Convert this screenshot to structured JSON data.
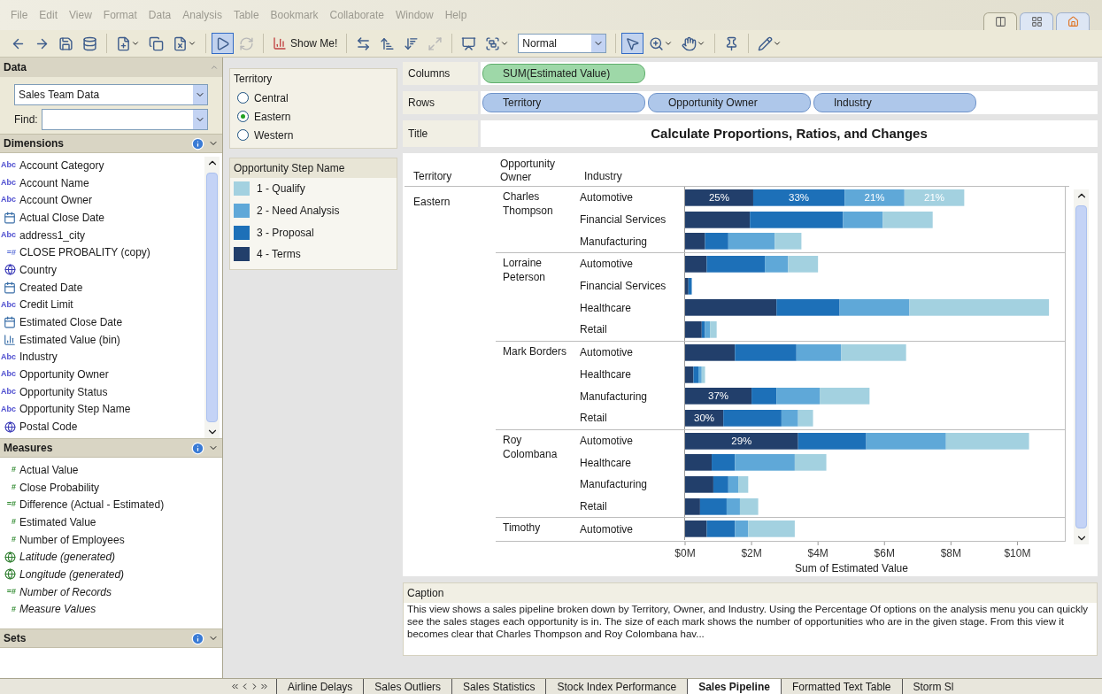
{
  "menu": [
    "File",
    "Edit",
    "View",
    "Format",
    "Data",
    "Analysis",
    "Table",
    "Bookmark",
    "Collaborate",
    "Window",
    "Help"
  ],
  "view_tabs": [
    {
      "kind": "sheet",
      "selected": true
    },
    {
      "kind": "grid",
      "selected": false
    },
    {
      "kind": "home",
      "selected": false
    }
  ],
  "toolbar": [
    {
      "kind": "back",
      "selected": false
    },
    {
      "kind": "forward",
      "selected": false
    },
    {
      "kind": "save",
      "selected": false
    },
    {
      "kind": "connect",
      "selected": false
    },
    {
      "kind": "sep"
    },
    {
      "kind": "new-sheet",
      "selected": false,
      "caret": true
    },
    {
      "kind": "duplicate",
      "selected": false
    },
    {
      "kind": "clear",
      "selected": false,
      "caret": true
    },
    {
      "kind": "sep"
    },
    {
      "kind": "run",
      "selected": true
    },
    {
      "kind": "refresh",
      "selected": false,
      "disabled": true
    },
    {
      "kind": "sep"
    },
    {
      "kind": "show-me",
      "label": "Show Me!",
      "selected": false
    },
    {
      "kind": "sep"
    },
    {
      "kind": "swap",
      "selected": false
    },
    {
      "kind": "sort-asc",
      "selected": false
    },
    {
      "kind": "sort-desc",
      "selected": false
    },
    {
      "kind": "fit",
      "selected": false,
      "disabled": true
    },
    {
      "kind": "sep"
    },
    {
      "kind": "present",
      "selected": false
    },
    {
      "kind": "group",
      "selected": false,
      "caret": true
    },
    {
      "kind": "select",
      "value": "Normal"
    },
    {
      "kind": "sep"
    },
    {
      "kind": "pointer",
      "selected": true
    },
    {
      "kind": "zoom",
      "selected": false,
      "caret": true
    },
    {
      "kind": "pan",
      "selected": false,
      "caret": true
    },
    {
      "kind": "sep"
    },
    {
      "kind": "pin",
      "selected": false
    },
    {
      "kind": "sep"
    },
    {
      "kind": "pen",
      "selected": false,
      "caret": true
    }
  ],
  "data_panel": {
    "title": "Data",
    "source": "Sales Team Data",
    "find_label": "Find:"
  },
  "dimensions": {
    "title": "Dimensions",
    "items": [
      {
        "kind": "string",
        "badge": "Abc",
        "name": "Account Category"
      },
      {
        "kind": "string",
        "badge": "Abc",
        "name": "Account Name"
      },
      {
        "kind": "string",
        "badge": "Abc",
        "name": "Account Owner"
      },
      {
        "kind": "date",
        "name": "Actual Close Date"
      },
      {
        "kind": "string",
        "badge": "Abc",
        "name": "address1_city"
      },
      {
        "kind": "calc",
        "badge": "=#",
        "name": "CLOSE PROBALITY (copy)"
      },
      {
        "kind": "geo",
        "name": "Country"
      },
      {
        "kind": "date",
        "name": "Created Date"
      },
      {
        "kind": "string",
        "badge": "Abc",
        "name": "Credit Limit"
      },
      {
        "kind": "date",
        "name": "Estimated Close Date"
      },
      {
        "kind": "bin",
        "name": "Estimated Value (bin)"
      },
      {
        "kind": "string",
        "badge": "Abc",
        "name": "Industry"
      },
      {
        "kind": "string",
        "badge": "Abc",
        "name": "Opportunity Owner"
      },
      {
        "kind": "string",
        "badge": "Abc",
        "name": "Opportunity Status"
      },
      {
        "kind": "string",
        "badge": "Abc",
        "name": "Opportunity Step Name"
      },
      {
        "kind": "geo",
        "name": "Postal Code"
      }
    ]
  },
  "measures": {
    "title": "Measures",
    "items": [
      {
        "kind": "number",
        "badge": "#",
        "name": "Actual Value",
        "generated": false
      },
      {
        "kind": "number",
        "badge": "#",
        "name": "Close Probability",
        "generated": false
      },
      {
        "kind": "calc",
        "badge": "=#",
        "name": "Difference (Actual - Estimated)",
        "generated": false
      },
      {
        "kind": "number",
        "badge": "#",
        "name": "Estimated Value",
        "generated": false
      },
      {
        "kind": "number",
        "badge": "#",
        "name": "Number of Employees",
        "generated": false
      },
      {
        "kind": "geo",
        "name": "Latitude (generated)",
        "generated": true
      },
      {
        "kind": "geo",
        "name": "Longitude (generated)",
        "generated": true
      },
      {
        "kind": "calc",
        "badge": "=#",
        "name": "Number of Records",
        "generated": true
      },
      {
        "kind": "number",
        "badge": "#",
        "name": "Measure Values",
        "generated": true
      }
    ]
  },
  "sets": {
    "title": "Sets"
  },
  "territory_filter": {
    "title": "Territory",
    "options": [
      {
        "label": "Central",
        "selected": false
      },
      {
        "label": "Eastern",
        "selected": true
      },
      {
        "label": "Western",
        "selected": false
      }
    ]
  },
  "legend": {
    "title": "Opportunity Step Name"
  },
  "shelves": [
    {
      "label": "Columns",
      "pills": [
        {
          "text": "SUM(Estimated Value)",
          "kind": "measure"
        }
      ]
    },
    {
      "label": "Rows",
      "pills": [
        {
          "text": "Territory",
          "kind": "dimension"
        },
        {
          "text": "Opportunity Owner",
          "kind": "dimension"
        },
        {
          "text": "Industry",
          "kind": "dimension"
        }
      ]
    }
  ],
  "title_shelf": {
    "label": "Title",
    "text": "Calculate Proportions, Ratios, and Changes"
  },
  "view": {
    "headers": [
      "Territory",
      "Opportunity Owner",
      "Industry"
    ],
    "territory": "Eastern",
    "owners": [
      {
        "name": "Charles Thompson",
        "rows": [
          {
            "bar_labels": [
              "25%",
              "33%",
              "21%",
              "21%"
            ]
          },
          {},
          {}
        ]
      },
      {
        "name": "Lorraine Peterson",
        "rows": [
          {},
          {},
          {},
          {}
        ]
      },
      {
        "name": "Mark Borders",
        "rows": [
          {},
          {},
          {
            "bar_labels": [
              "37%"
            ]
          },
          {
            "bar_labels": [
              "30%"
            ]
          }
        ]
      },
      {
        "name": "Roy Colombana",
        "rows": [
          {
            "bar_labels": [
              "29%"
            ]
          },
          {},
          {},
          {}
        ]
      },
      {
        "name": "Timothy",
        "rows": [
          {}
        ]
      }
    ],
    "chart_data": {
      "type": "bar",
      "orientation": "horizontal",
      "stacked": true,
      "xlabel": "Sum of Estimated Value",
      "xlim": [
        0,
        11.4
      ],
      "categories": [
        "Automotive",
        "Financial Services",
        "Manufacturing",
        "Automotive",
        "Financial Services",
        "Healthcare",
        "Retail",
        "Automotive",
        "Healthcare",
        "Manufacturing",
        "Retail",
        "Automotive",
        "Healthcare",
        "Manufacturing",
        "Retail",
        "Automotive"
      ],
      "xticks": [
        {
          "value": 0,
          "label": "$0M"
        },
        {
          "value": 2,
          "label": "$2M"
        },
        {
          "value": 4,
          "label": "$4M"
        },
        {
          "value": 6,
          "label": "$6M"
        },
        {
          "value": 8,
          "label": "$8M"
        },
        {
          "value": 10,
          "label": "$10M"
        }
      ],
      "series": [
        {
          "name": "4 - Terms",
          "color": "#223f6b",
          "values": [
            2.05,
            1.95,
            0.6,
            0.65,
            0.1,
            2.75,
            0.5,
            1.5,
            0.25,
            2,
            1.15,
            3.4,
            0.8,
            0.85,
            0.45,
            0.65
          ]
        },
        {
          "name": "3 - Proposal",
          "color": "#1d70b8",
          "values": [
            2.75,
            2.8,
            0.7,
            1.75,
            0.1,
            1.9,
            0.1,
            1.85,
            0.15,
            0.75,
            1.75,
            2.05,
            0.7,
            0.45,
            0.8,
            0.85
          ]
        },
        {
          "name": "2 - Need Analysis",
          "color": "#5fa8d8",
          "values": [
            1.8,
            1.2,
            1.4,
            0.7,
            0,
            2.1,
            0.15,
            1.35,
            0.1,
            1.3,
            0.5,
            2.4,
            1.8,
            0.3,
            0.4,
            0.4
          ]
        },
        {
          "name": "1 - Qualify",
          "color": "#a3d1e0",
          "values": [
            1.8,
            1.5,
            0.8,
            0.9,
            0,
            4.2,
            0.2,
            1.95,
            0.1,
            1.5,
            0.45,
            2.5,
            0.95,
            0.3,
            0.55,
            1.4
          ]
        }
      ]
    }
  },
  "caption": {
    "title": "Caption",
    "text": "This view shows a sales pipeline broken down by Territory, Owner, and Industry. Using the Percentage Of options on the analysis menu you can quickly see the sales stages each opportunity is in. The size of each mark shows the number of opportunities who are in the given stage. From this view it becomes clear that Charles Thompson and Roy Colombana hav..."
  },
  "sheet_tabs": [
    {
      "label": "Airline Delays",
      "selected": false
    },
    {
      "label": "Sales Outliers",
      "selected": false
    },
    {
      "label": "Sales Statistics",
      "selected": false
    },
    {
      "label": "Stock Index Performance",
      "selected": false
    },
    {
      "label": "Sales Pipeline",
      "selected": true
    },
    {
      "label": "Formatted Text Table",
      "selected": false
    },
    {
      "label": "Storm Sl",
      "selected": false
    }
  ]
}
